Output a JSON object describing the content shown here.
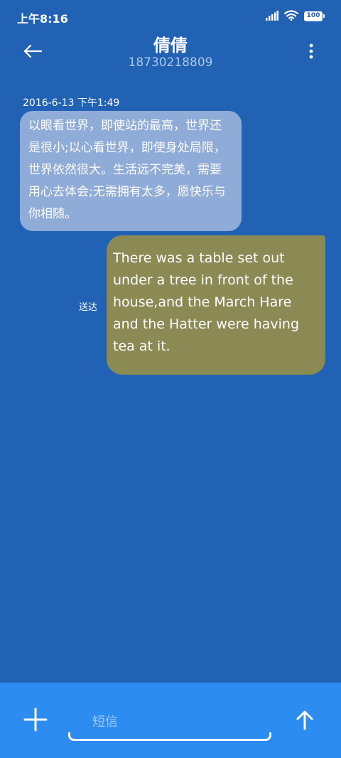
{
  "status_bar": {
    "time": "上午8:16",
    "battery": "100",
    "icons": [
      "signal-icon",
      "wifi-icon",
      "battery-icon"
    ]
  },
  "header": {
    "back_icon": "back-arrow-icon",
    "contact_name": "倩倩",
    "contact_number": "18730218809",
    "more_icon": "more-vertical-icon"
  },
  "conversation": {
    "timestamp": "2016-6-13 下午1:49",
    "received_message": "以眼看世界，即使站的最高，世界还是很小;以心看世界，即使身处局限，世界依然很大。生活远不完美，需要用心去体会;无需拥有太多，愿快乐与你相随。",
    "sent_message": "There was a table set out under a tree in front of the house,and the March Hare and the Hatter were having tea at it.",
    "sent_status": "送达"
  },
  "composer": {
    "add_icon": "plus-icon",
    "placeholder": "短信",
    "value": "",
    "send_icon": "send-arrow-up-icon"
  },
  "colors": {
    "background": "#2262b4",
    "received_bubble": "#8fabd8",
    "sent_bubble": "#8b8954",
    "input_bar": "#2d8cf0",
    "contact_number": "#a9c6ec"
  }
}
